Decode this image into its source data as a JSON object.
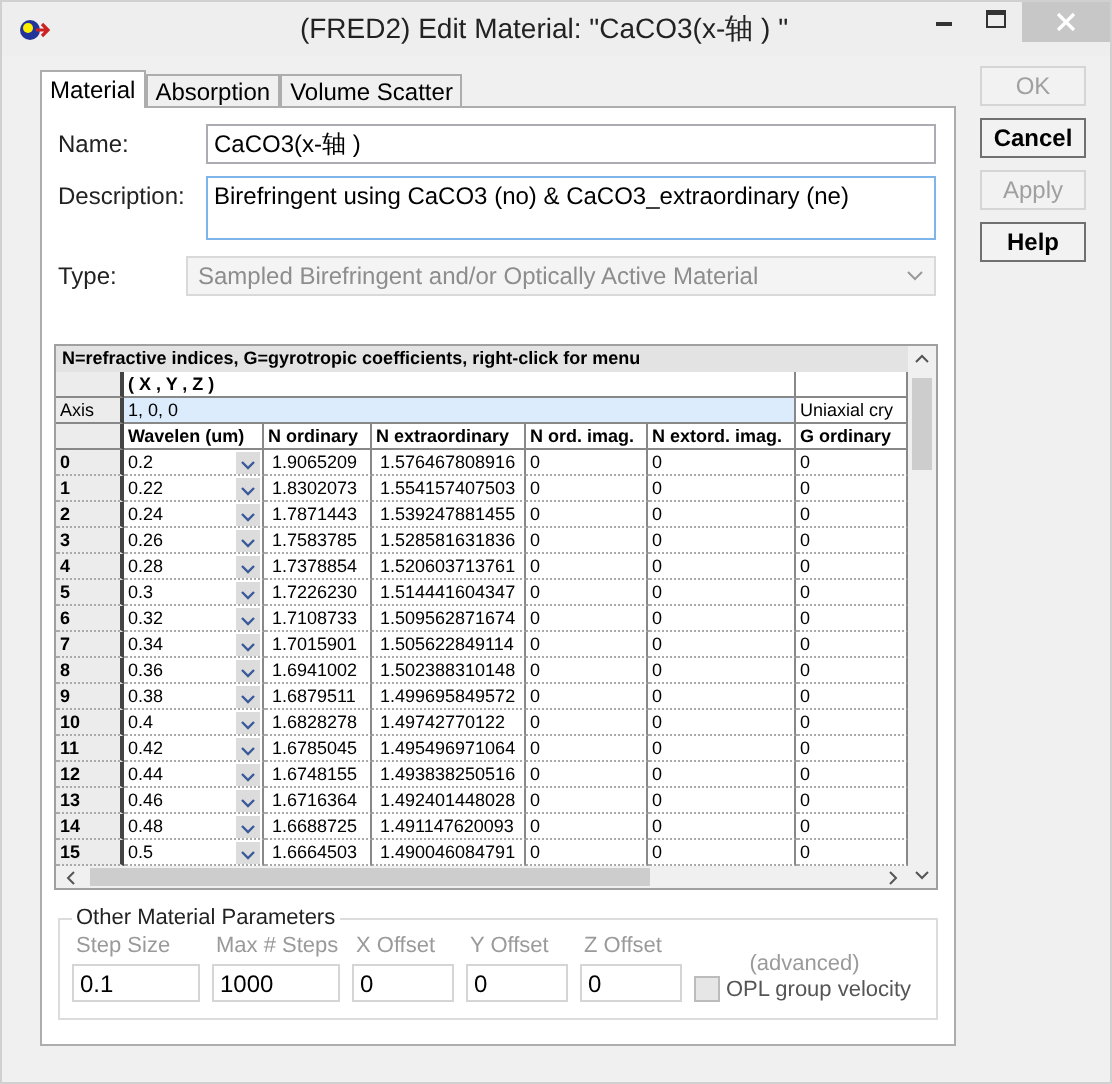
{
  "window": {
    "title": "(FRED2) Edit Material: \"CaCO3(x-轴 ) \""
  },
  "tabs": [
    {
      "label": "Material",
      "selected": true
    },
    {
      "label": "Absorption",
      "selected": false
    },
    {
      "label": "Volume Scatter",
      "selected": false
    }
  ],
  "buttons": [
    {
      "label": "OK",
      "disabled": true
    },
    {
      "label": "Cancel",
      "disabled": false
    },
    {
      "label": "Apply",
      "disabled": true
    },
    {
      "label": "Help",
      "disabled": false
    }
  ],
  "name": {
    "label": "Name:",
    "value": "CaCO3(x-轴 )"
  },
  "description": {
    "label": "Description:",
    "value": "Birefringent using CaCO3 (no) & CaCO3_extraordinary (ne)"
  },
  "type": {
    "label": "Type:",
    "value": "Sampled Birefringent and/or Optically Active Material",
    "disabled": true
  },
  "table": {
    "caption": "N=refractive indices,  G=gyrotropic coefficients,  right-click for menu",
    "coord_header": "( X , Y , Z )",
    "axis_label": "Axis",
    "axis_value": "1,  0,  0",
    "extra_header": "Uniaxial cry",
    "columns": [
      "Wavelen (um)",
      "N ordinary",
      "N extraordinary",
      "N ord. imag.",
      "N extord. imag.",
      "G ordinary"
    ],
    "rows": [
      {
        "index": "0",
        "cells": [
          "0.2",
          "1.9065209",
          "1.576467808916",
          "0",
          "0",
          "0"
        ]
      },
      {
        "index": "1",
        "cells": [
          "0.22",
          "1.8302073",
          "1.554157407503",
          "0",
          "0",
          "0"
        ]
      },
      {
        "index": "2",
        "cells": [
          "0.24",
          "1.7871443",
          "1.539247881455",
          "0",
          "0",
          "0"
        ]
      },
      {
        "index": "3",
        "cells": [
          "0.26",
          "1.7583785",
          "1.528581631836",
          "0",
          "0",
          "0"
        ]
      },
      {
        "index": "4",
        "cells": [
          "0.28",
          "1.7378854",
          "1.520603713761",
          "0",
          "0",
          "0"
        ]
      },
      {
        "index": "5",
        "cells": [
          "0.3",
          "1.7226230",
          "1.514441604347",
          "0",
          "0",
          "0"
        ]
      },
      {
        "index": "6",
        "cells": [
          "0.32",
          "1.7108733",
          "1.509562871674",
          "0",
          "0",
          "0"
        ]
      },
      {
        "index": "7",
        "cells": [
          "0.34",
          "1.7015901",
          "1.505622849114",
          "0",
          "0",
          "0"
        ]
      },
      {
        "index": "8",
        "cells": [
          "0.36",
          "1.6941002",
          "1.502388310148",
          "0",
          "0",
          "0"
        ]
      },
      {
        "index": "9",
        "cells": [
          "0.38",
          "1.6879511",
          "1.499695849572",
          "0",
          "0",
          "0"
        ]
      },
      {
        "index": "10",
        "cells": [
          "0.4",
          "1.6828278",
          "1.49742770122",
          "0",
          "0",
          "0"
        ]
      },
      {
        "index": "11",
        "cells": [
          "0.42",
          "1.6785045",
          "1.495496971064",
          "0",
          "0",
          "0"
        ]
      },
      {
        "index": "12",
        "cells": [
          "0.44",
          "1.6748155",
          "1.493838250516",
          "0",
          "0",
          "0"
        ]
      },
      {
        "index": "13",
        "cells": [
          "0.46",
          "1.6716364",
          "1.492401448028",
          "0",
          "0",
          "0"
        ]
      },
      {
        "index": "14",
        "cells": [
          "0.48",
          "1.6688725",
          "1.491147620093",
          "0",
          "0",
          "0"
        ]
      },
      {
        "index": "15",
        "cells": [
          "0.5",
          "1.6664503",
          "1.490046084791",
          "0",
          "0",
          "0"
        ]
      }
    ]
  },
  "other_parameters": {
    "title": "Other Material Parameters",
    "fields": [
      {
        "label": "Step Size",
        "value": "0.1",
        "disabled": true
      },
      {
        "label": "Max # Steps",
        "value": "1000",
        "disabled": true
      },
      {
        "label": "X Offset",
        "value": "0",
        "disabled": true
      },
      {
        "label": "Y Offset",
        "value": "0",
        "disabled": true
      },
      {
        "label": "Z Offset",
        "value": "0",
        "disabled": true
      }
    ],
    "advanced_label": "(advanced)",
    "checkbox": {
      "label": "OPL group velocity",
      "checked": false,
      "disabled": true
    }
  }
}
